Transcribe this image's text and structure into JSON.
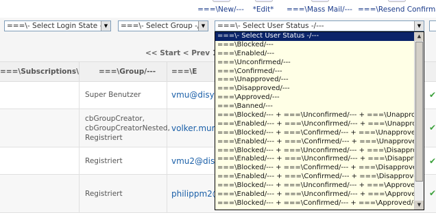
{
  "toolbar": {
    "new_label": "===\\New/---",
    "edit_label": "*Edit*",
    "massmail_label": "===\\Mass Mail/---",
    "resend_label": "===\\Resend Confirmatio"
  },
  "filters": {
    "login_state": "===\\- Select Login State -/---",
    "group": "===\\- Select Group -/---",
    "user_status": "===\\- Select User Status -/---"
  },
  "pagination": {
    "text": "<< Start < Prev 1 Ne"
  },
  "table": {
    "headers": {
      "subscriptions": "===\\Subscriptions\\/---",
      "group": "===\\Group/---",
      "email": "===\\E"
    },
    "rows": [
      {
        "group": "Super Benutzer",
        "email": "vmu@disyl"
      },
      {
        "group": "cbGroupCreator,\ncbGroupCreatorNested,\nRegistriert",
        "email": "volker.murr"
      },
      {
        "group": "Registriert",
        "email": "vmu2@dis"
      },
      {
        "group": "Registriert",
        "email": "philippm2@"
      }
    ],
    "status_icon": "check-icon"
  },
  "dropdown": {
    "options": [
      "===\\- Select User Status -/---",
      "===\\Blocked/---",
      "===\\Enabled/---",
      "===\\Unconfirmed/---",
      "===\\Confirmed/---",
      "===\\Unapproved/---",
      "===\\Disapproved/---",
      "===\\Approved/---",
      "===\\Banned/---",
      "===\\Blocked/--- + ===\\Unconfirmed/--- + ===\\Unapproved/---",
      "===\\Enabled/--- + ===\\Unconfirmed/--- + ===\\Unapproved/---",
      "===\\Blocked/--- + ===\\Confirmed/--- + ===\\Unapproved/---",
      "===\\Enabled/--- + ===\\Confirmed/--- + ===\\Unapproved/---",
      "===\\Blocked/--- + ===\\Unconfirmed/--- + ===\\Disapproved/---",
      "===\\Enabled/--- + ===\\Unconfirmed/--- + ===\\Disapproved/---",
      "===\\Blocked/--- + ===\\Confirmed/--- + ===\\Disapproved/---",
      "===\\Enabled/--- + ===\\Confirmed/--- + ===\\Disapproved/---",
      "===\\Blocked/--- + ===\\Unconfirmed/--- + ===\\Approved/---",
      "===\\Enabled/--- + ===\\Unconfirmed/--- + ===\\Approved/---",
      "===\\Blocked/--- + ===\\Confirmed/--- + ===\\Approved/---"
    ],
    "selected_index": 0
  },
  "colors": {
    "link": "#1a5fa8",
    "dropdown_bg": "#ffffe6",
    "selected_bg": "#0a246a",
    "check": "#3aa03a"
  }
}
